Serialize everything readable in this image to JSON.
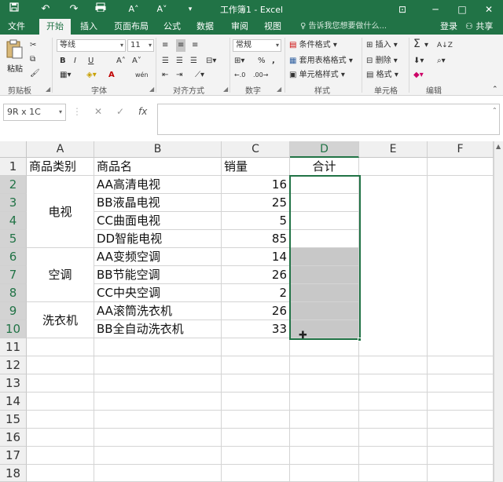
{
  "titlebar": {
    "title": "工作簿1 - Excel",
    "quick_access": [
      "save-icon",
      "undo-icon",
      "redo-icon",
      "customize-icon"
    ],
    "font_grow": "A˄",
    "font_shrink": "A˅",
    "btn_minimize": "─",
    "btn_maximize": "□",
    "btn_close": "✕",
    "ribbon_display": "⊡"
  },
  "menu": {
    "tabs": [
      "文件",
      "开始",
      "插入",
      "页面布局",
      "公式",
      "数据",
      "审阅",
      "视图"
    ],
    "active_tab": "开始",
    "tell_me": "告诉我您想要做什么...",
    "login": "登录",
    "share": "共享"
  },
  "ribbon": {
    "clipboard": {
      "label": "剪贴板",
      "paste": "粘贴"
    },
    "font": {
      "label": "字体",
      "name": "等线",
      "size": "11",
      "bold": "B",
      "italic": "I",
      "underline": "U",
      "grow": "A˄",
      "shrink": "A˅",
      "font_color": "A",
      "phonetic": "wén"
    },
    "alignment": {
      "label": "对齐方式"
    },
    "number": {
      "label": "数字",
      "format": "常规",
      "percent": "%",
      "comma": ","
    },
    "styles": {
      "label": "样式",
      "conditional": "条件格式",
      "table": "套用表格格式",
      "cell_styles": "单元格样式"
    },
    "cells": {
      "label": "单元格",
      "insert": "插入",
      "delete": "删除",
      "format": "格式"
    },
    "editing": {
      "label": "编辑",
      "sum": "Σ",
      "sort": "A↓Z"
    }
  },
  "formula_bar": {
    "name_box": "9R x 1C",
    "cancel": "✕",
    "enter": "✓",
    "fx": "fx",
    "value": ""
  },
  "sheet": {
    "columns": [
      "A",
      "B",
      "C",
      "D",
      "E",
      "F"
    ],
    "rows": [
      "1",
      "2",
      "3",
      "4",
      "5",
      "6",
      "7",
      "8",
      "9",
      "10",
      "11",
      "12",
      "13",
      "14",
      "15",
      "16",
      "17",
      "18"
    ],
    "header": {
      "a": "商品类别",
      "b": "商品名",
      "c": "销量",
      "d": "合计"
    },
    "categories": [
      "电视",
      "空调",
      "洗衣机"
    ],
    "products": [
      "AA高清电视",
      "BB液晶电视",
      "CC曲面电视",
      "DD智能电视",
      "AA变频空调",
      "BB节能空调",
      "CC中央空调",
      "AA滚筒洗衣机",
      "BB全自动洗衣机"
    ],
    "sales": [
      "16",
      "25",
      "5",
      "85",
      "14",
      "26",
      "2",
      "26",
      "33"
    ],
    "selection": "D2:D10"
  }
}
